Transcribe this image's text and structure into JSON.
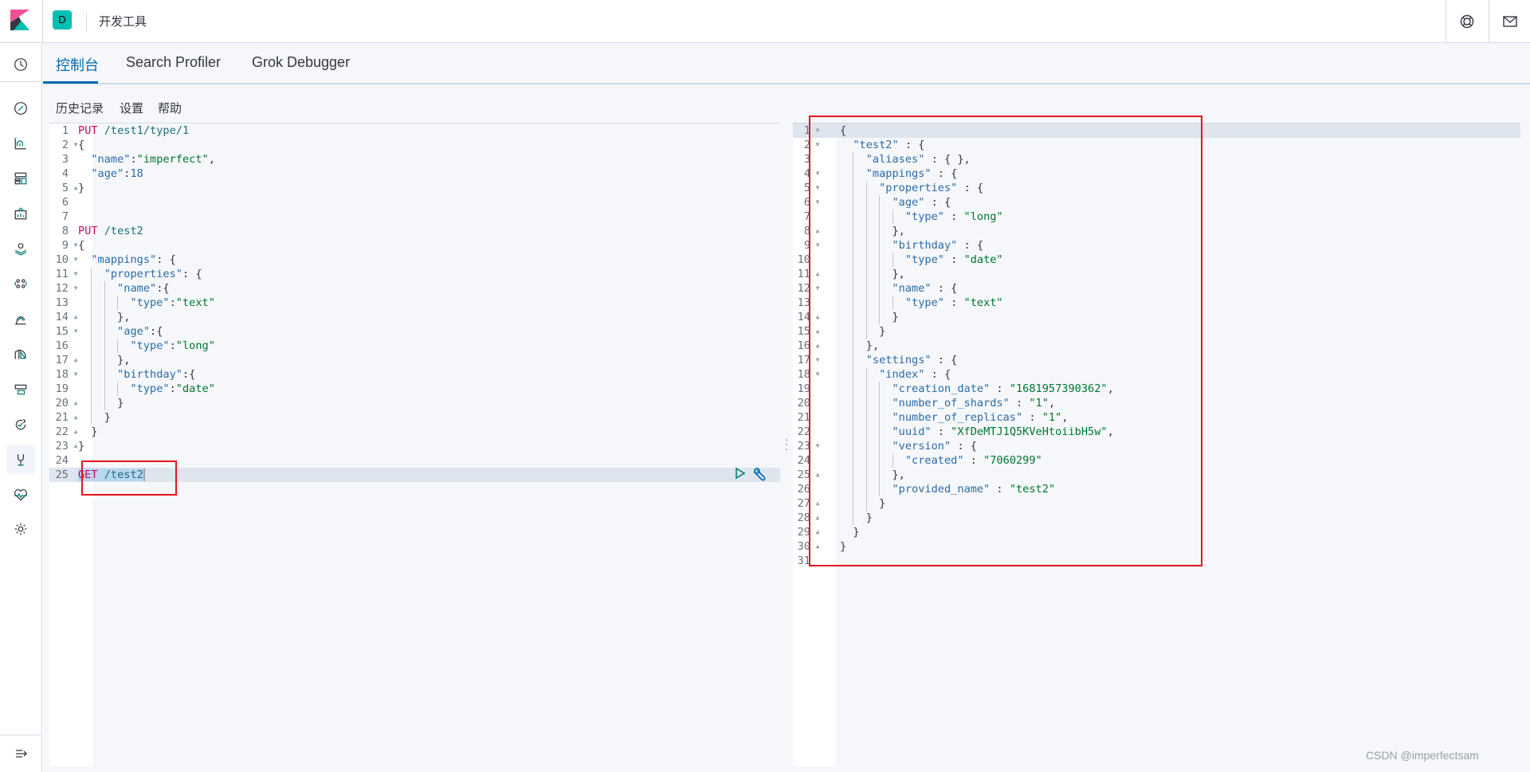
{
  "header": {
    "title": "开发工具",
    "space_initial": "D",
    "icons": [
      "help-icon",
      "mail-icon"
    ]
  },
  "colors": {
    "accent": "#006bb4",
    "space": "#00bfb3",
    "method": "#c80a68",
    "string": "#00772f",
    "key": "#2b6ba7",
    "highlight_box": "#e5141e"
  },
  "leftnav": {
    "items": [
      "clock-icon",
      "compass-icon",
      "visualize-icon",
      "dashboard-icon",
      "canvas-icon",
      "maps-icon",
      "machine-learning-icon",
      "infrastructure-icon",
      "logs-icon",
      "apm-icon",
      "uptime-icon",
      "dev-tools-icon",
      "monitoring-icon",
      "management-icon"
    ],
    "active": "dev-tools-icon",
    "collapse_icon": "collapse-nav-icon"
  },
  "tabs": [
    {
      "label": "控制台",
      "active": true
    },
    {
      "label": "Search Profiler",
      "active": false
    },
    {
      "label": "Grok Debugger",
      "active": false
    }
  ],
  "submenu": [
    "历史记录",
    "设置",
    "帮助"
  ],
  "request_editor": {
    "active_line": 25,
    "selected_text": "GET /test2",
    "lines": [
      {
        "text": "PUT /test1/type/1",
        "fold": ""
      },
      {
        "text": "{",
        "fold": "open"
      },
      {
        "text": "  \"name\":\"imperfect\",",
        "fold": ""
      },
      {
        "text": "  \"age\":18",
        "fold": ""
      },
      {
        "text": "}",
        "fold": "close"
      },
      {
        "text": "",
        "fold": ""
      },
      {
        "text": "",
        "fold": ""
      },
      {
        "text": "PUT /test2",
        "fold": ""
      },
      {
        "text": "{",
        "fold": "open"
      },
      {
        "text": "  \"mappings\": {",
        "fold": "open"
      },
      {
        "text": "    \"properties\": {",
        "fold": "open"
      },
      {
        "text": "      \"name\":{",
        "fold": "open"
      },
      {
        "text": "        \"type\":\"text\"",
        "fold": ""
      },
      {
        "text": "      },",
        "fold": "close"
      },
      {
        "text": "      \"age\":{",
        "fold": "open"
      },
      {
        "text": "        \"type\":\"long\"",
        "fold": ""
      },
      {
        "text": "      },",
        "fold": "close"
      },
      {
        "text": "      \"birthday\":{",
        "fold": "open"
      },
      {
        "text": "        \"type\":\"date\"",
        "fold": ""
      },
      {
        "text": "      }",
        "fold": "close"
      },
      {
        "text": "    }",
        "fold": "close"
      },
      {
        "text": "  }",
        "fold": "close"
      },
      {
        "text": "}",
        "fold": "close"
      },
      {
        "text": "",
        "fold": ""
      },
      {
        "text": "GET /test2",
        "fold": ""
      }
    ],
    "action_icons": [
      "play-icon",
      "wrench-icon"
    ]
  },
  "response_editor": {
    "active_line": 1,
    "lines": [
      {
        "text": "{",
        "fold": "open"
      },
      {
        "text": "  \"test2\" : {",
        "fold": "open"
      },
      {
        "text": "    \"aliases\" : { },",
        "fold": ""
      },
      {
        "text": "    \"mappings\" : {",
        "fold": "open"
      },
      {
        "text": "      \"properties\" : {",
        "fold": "open"
      },
      {
        "text": "        \"age\" : {",
        "fold": "open"
      },
      {
        "text": "          \"type\" : \"long\"",
        "fold": ""
      },
      {
        "text": "        },",
        "fold": "close"
      },
      {
        "text": "        \"birthday\" : {",
        "fold": "open"
      },
      {
        "text": "          \"type\" : \"date\"",
        "fold": ""
      },
      {
        "text": "        },",
        "fold": "close"
      },
      {
        "text": "        \"name\" : {",
        "fold": "open"
      },
      {
        "text": "          \"type\" : \"text\"",
        "fold": ""
      },
      {
        "text": "        }",
        "fold": "close"
      },
      {
        "text": "      }",
        "fold": "close"
      },
      {
        "text": "    },",
        "fold": "close"
      },
      {
        "text": "    \"settings\" : {",
        "fold": "open"
      },
      {
        "text": "      \"index\" : {",
        "fold": "open"
      },
      {
        "text": "        \"creation_date\" : \"1681957390362\",",
        "fold": ""
      },
      {
        "text": "        \"number_of_shards\" : \"1\",",
        "fold": ""
      },
      {
        "text": "        \"number_of_replicas\" : \"1\",",
        "fold": ""
      },
      {
        "text": "        \"uuid\" : \"XfDeMTJ1Q5KVeHtoiibH5w\",",
        "fold": ""
      },
      {
        "text": "        \"version\" : {",
        "fold": "open"
      },
      {
        "text": "          \"created\" : \"7060299\"",
        "fold": ""
      },
      {
        "text": "        },",
        "fold": "close"
      },
      {
        "text": "        \"provided_name\" : \"test2\"",
        "fold": ""
      },
      {
        "text": "      }",
        "fold": "close"
      },
      {
        "text": "    }",
        "fold": "close"
      },
      {
        "text": "  }",
        "fold": "close"
      },
      {
        "text": "}",
        "fold": "close"
      },
      {
        "text": "",
        "fold": ""
      }
    ]
  },
  "watermark": "CSDN @imperfectsam"
}
